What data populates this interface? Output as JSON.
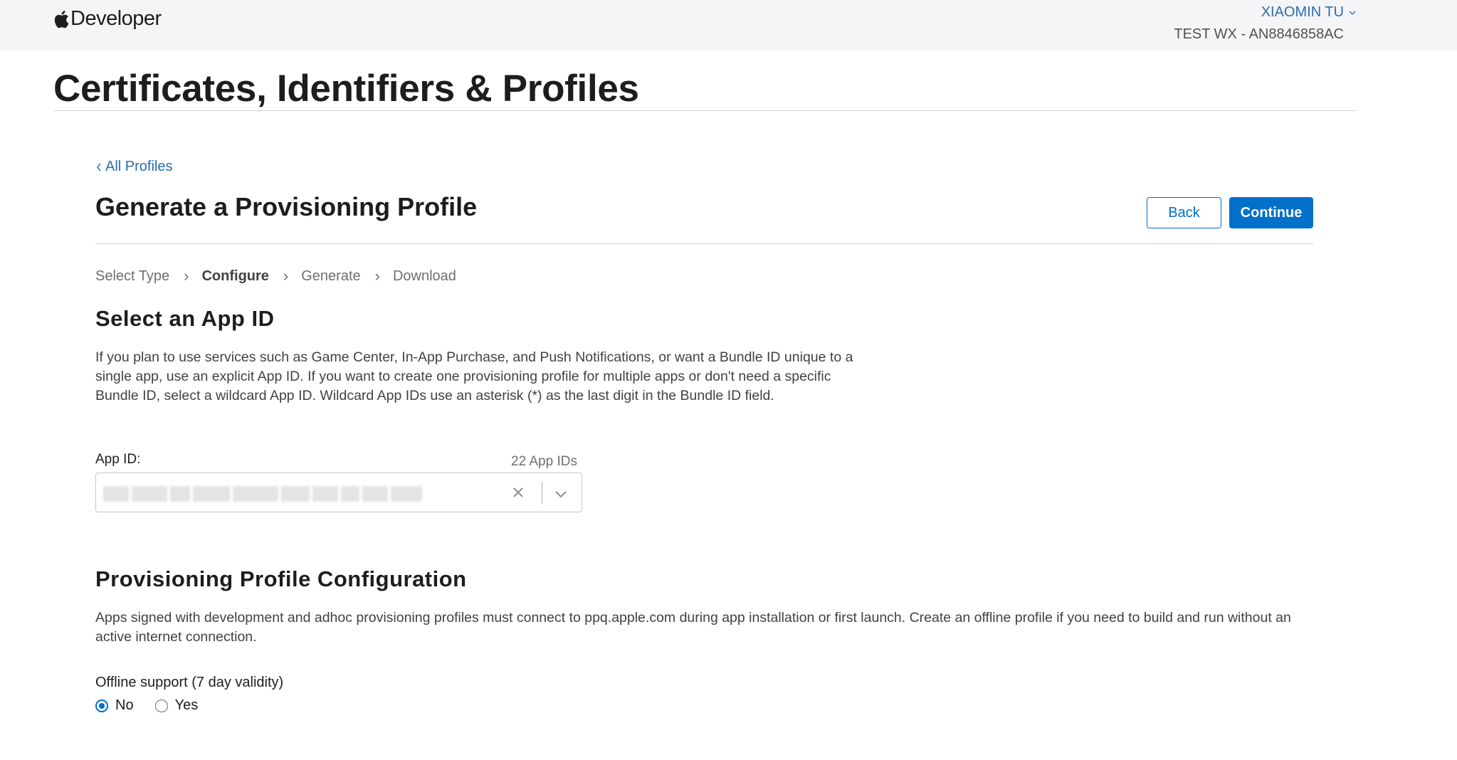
{
  "nav": {
    "brand_icon": "apple-logo-icon",
    "brand_text": "Developer",
    "account_name": "XIAOMIN TU",
    "account_team": "TEST WX - AN8846858AC"
  },
  "page": {
    "title": "Certificates, Identifiers & Profiles"
  },
  "content": {
    "back_link": "All Profiles",
    "section_title": "Generate a Provisioning Profile",
    "buttons": {
      "back": "Back",
      "continue": "Continue"
    },
    "steps": [
      {
        "label": "Select Type",
        "active": false
      },
      {
        "label": "Configure",
        "active": true
      },
      {
        "label": "Generate",
        "active": false
      },
      {
        "label": "Download",
        "active": false
      }
    ],
    "app_id_section": {
      "heading": "Select an App ID",
      "description": "If you plan to use services such as Game Center, In-App Purchase, and Push Notifications, or want a Bundle ID unique to a single app, use an explicit App ID. If you want to create one provisioning profile for multiple apps or don't need a specific Bundle ID, select a wildcard App ID. Wildcard App IDs use an asterisk (*) as the last digit in the Bundle ID field.",
      "field_label": "App ID:",
      "count": "22 App IDs",
      "selected_value": ""
    },
    "config_section": {
      "heading": "Provisioning Profile Configuration",
      "description": "Apps signed with development and adhoc provisioning profiles must connect to ppq.apple.com during app installation or first launch. Create an offline profile if you need to build and run without an active internet connection.",
      "offline_label": "Offline support (7 day validity)",
      "options": [
        {
          "label": "No",
          "checked": true
        },
        {
          "label": "Yes",
          "checked": false
        }
      ]
    }
  },
  "colors": {
    "accent": "#0070c9",
    "link": "#2b6cb0",
    "nav_bg": "#f5f5f7"
  }
}
